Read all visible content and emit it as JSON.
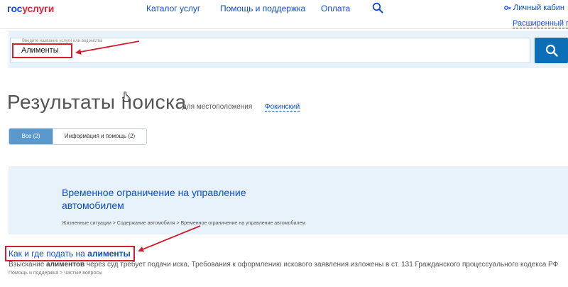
{
  "header": {
    "logo_part1": "гос",
    "logo_part2": "услуги",
    "nav": [
      "Каталог услуг",
      "Помощь и поддержка",
      "Оплата"
    ],
    "cabinet_label": "Личный кабин",
    "advanced_search": "Расширенный пои"
  },
  "search": {
    "hint": "Введите название услуги или ведомства",
    "value": "Алименты"
  },
  "results": {
    "title": "Результаты поиска",
    "location_prefix": "для местоположения",
    "location_city": "Фокинский",
    "tabs": [
      {
        "label": "Все (2)",
        "active": true
      },
      {
        "label": "Информация и помощь (2)",
        "active": false
      }
    ]
  },
  "card": {
    "title": "Временное ограничение на управление автомобилем",
    "breadcrumbs": "Жизненные ситуации > Содержание автомобиля > Временное ограничение на управление автомобилем"
  },
  "result2": {
    "title_prefix": "Как и где подать на ",
    "title_bold": "алименты",
    "desc_prefix": "Взыскание ",
    "desc_bold": "алиментов",
    "desc_rest": " через суд требует подачи иска. Требования к оформлению искового заявления изложены в ст. 131 Гражданского процессуального кодекса РФ",
    "breadcrumbs": "Помощь и поддержка > Частые вопросы"
  },
  "colors": {
    "accent": "#0d4cd3",
    "logo_red": "#e32636",
    "search_button": "#0d6eb8",
    "band_bg": "#e7f2fb",
    "annotation_red": "#d01f2e",
    "active_tab": "#5b99cc"
  },
  "icons": [
    "search-icon",
    "key-icon",
    "cursor-icon"
  ]
}
